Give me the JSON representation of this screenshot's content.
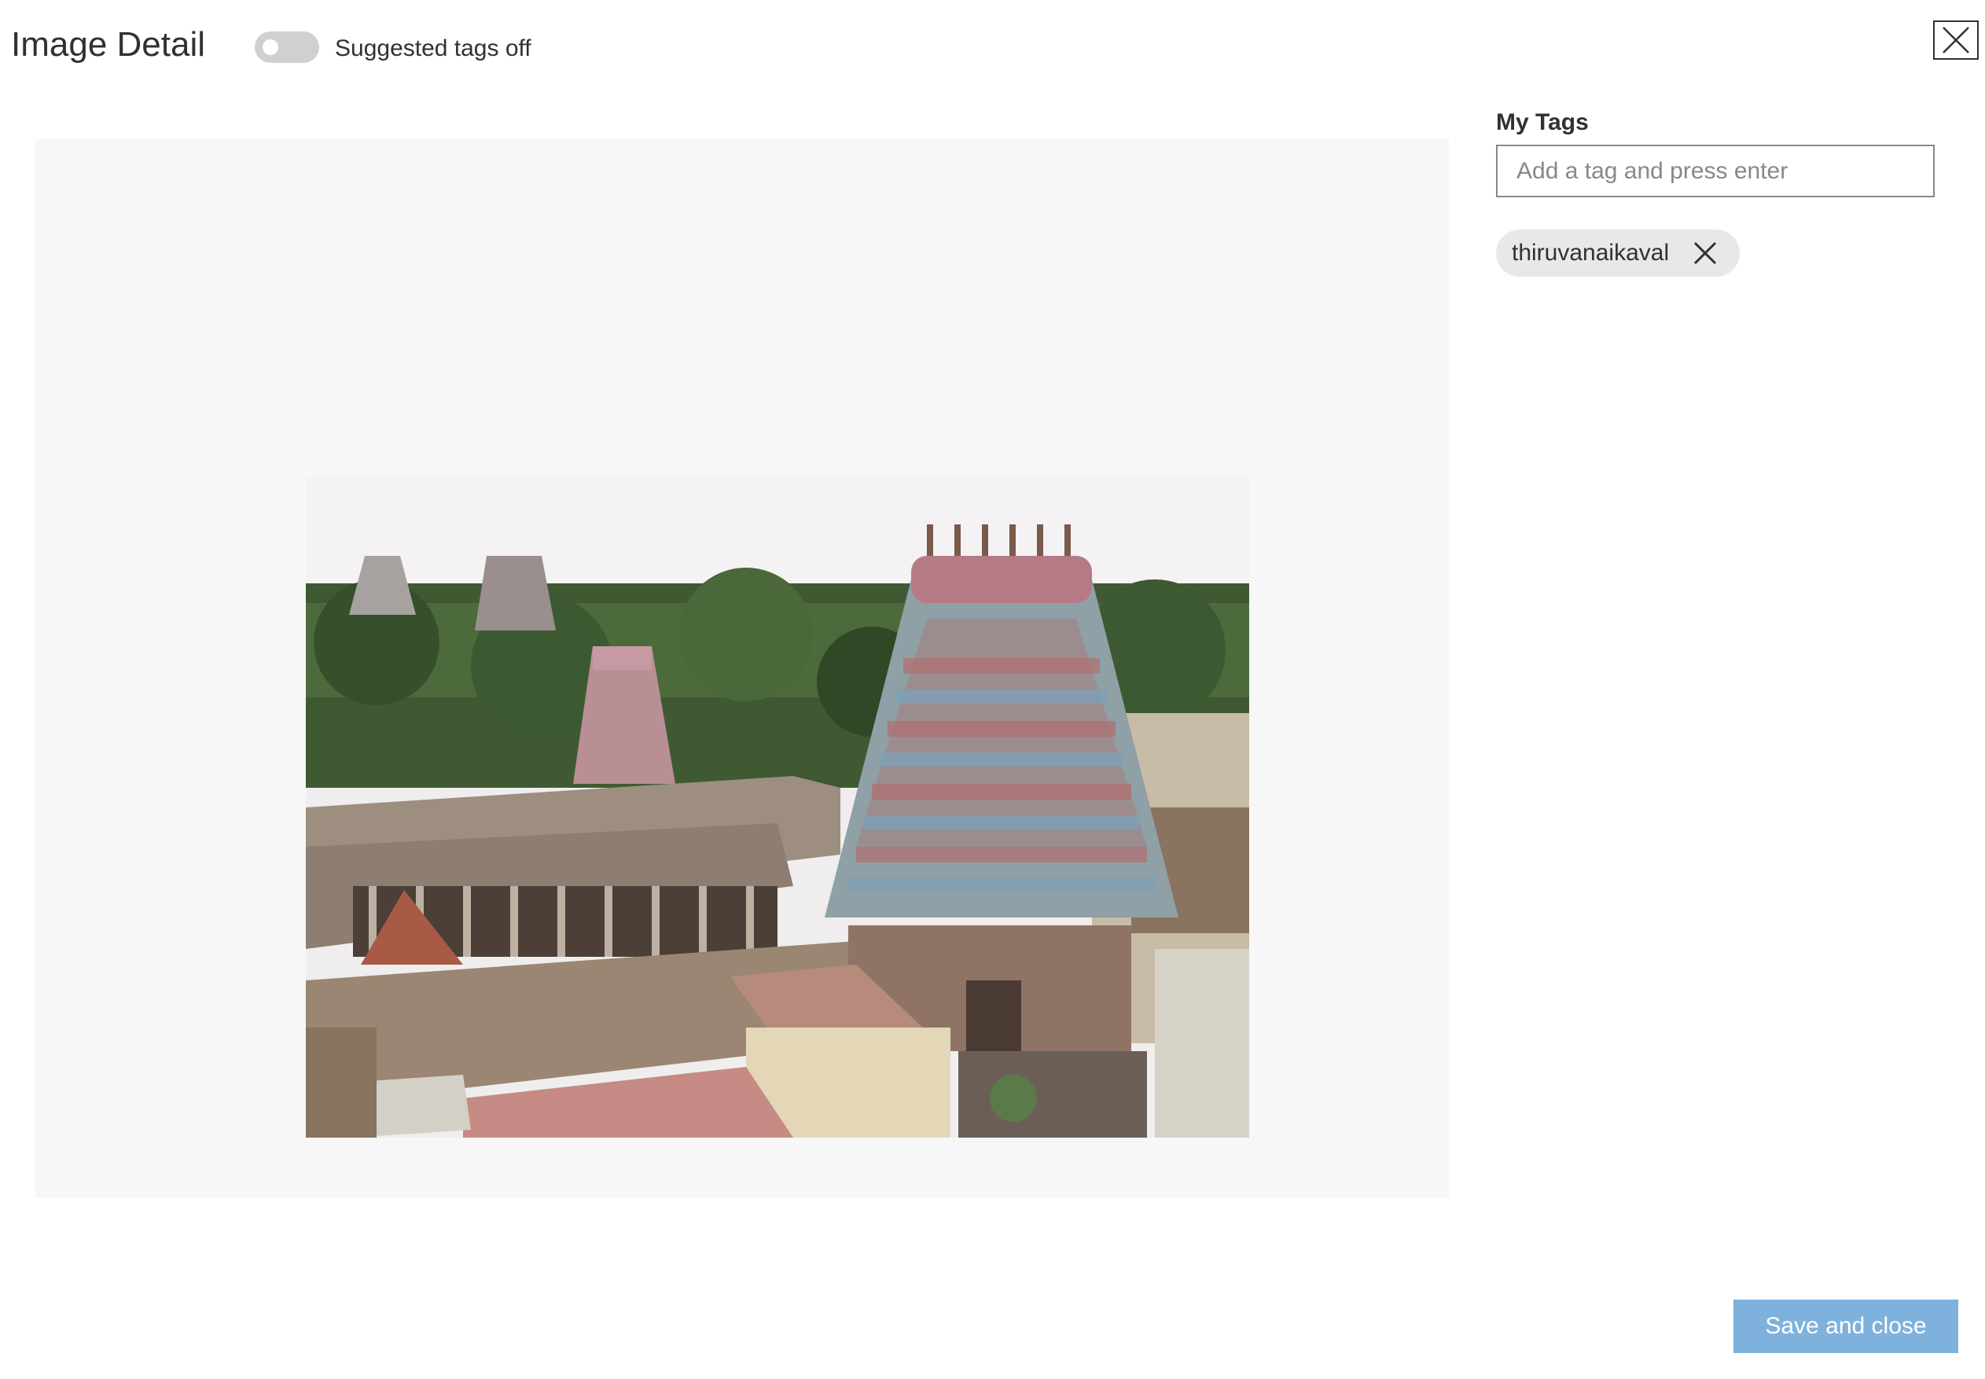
{
  "header": {
    "title": "Image Detail",
    "suggested_tags_toggle": {
      "label": "Suggested tags off",
      "on": false
    },
    "close_icon": "close-icon"
  },
  "preview": {
    "icon": "photo",
    "colors": {
      "background": "#f7f7f7"
    }
  },
  "tags_panel": {
    "heading": "My Tags",
    "input_placeholder": "Add a tag and press enter",
    "input_value": "",
    "tags": [
      {
        "label": "thiruvanaikaval",
        "remove_icon": "close-icon"
      }
    ]
  },
  "footer": {
    "save_label": "Save and close",
    "colors": {
      "save_background": "#7eb1dc"
    }
  }
}
